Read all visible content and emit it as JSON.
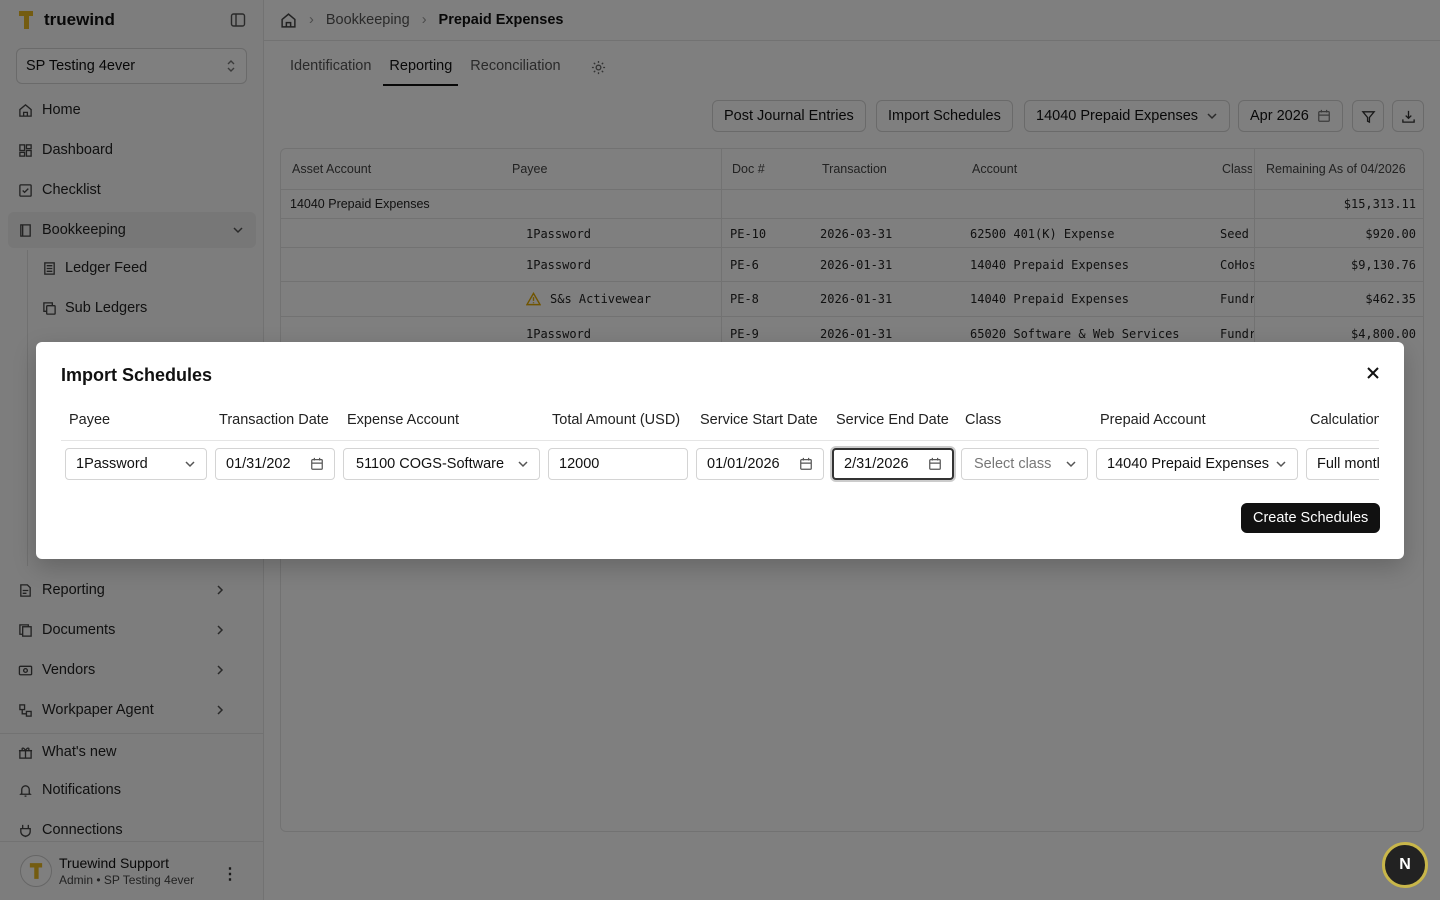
{
  "brand": {
    "name": "truewind"
  },
  "org_select": {
    "value": "SP Testing 4ever"
  },
  "nav": {
    "home": "Home",
    "dashboard": "Dashboard",
    "checklist": "Checklist",
    "bookkeeping": "Bookkeeping",
    "ledger_feed": "Ledger Feed",
    "sub_ledgers": "Sub Ledgers",
    "reporting": "Reporting",
    "documents": "Documents",
    "vendors": "Vendors",
    "workpaper_agent": "Workpaper Agent",
    "whats_new": "What's new",
    "notifications": "Notifications",
    "connections": "Connections"
  },
  "user": {
    "name": "Truewind Support",
    "role": "Admin • SP Testing 4ever"
  },
  "breadcrumb": {
    "parent": "Bookkeeping",
    "current": "Prepaid Expenses"
  },
  "tabs": {
    "identification": "Identification",
    "reporting": "Reporting",
    "reconciliation": "Reconciliation"
  },
  "toolbar": {
    "post": "Post Journal Entries",
    "import": "Import Schedules",
    "account": "14040 Prepaid Expenses",
    "period": "Apr 2026"
  },
  "table": {
    "headers": {
      "asset": "Asset Account",
      "payee": "Payee",
      "doc": "Doc #",
      "txn": "Transaction",
      "account": "Account",
      "class": "Class",
      "remaining": "Remaining As of 04/2026"
    },
    "group": {
      "label": "14040 Prepaid Expenses",
      "total": "$15,313.11"
    },
    "rows": [
      {
        "payee": "1Password",
        "doc": "PE-10",
        "date": "2026-03-31",
        "account": "62500 401(K) Expense",
        "class": "Seed I",
        "amount": "$920.00"
      },
      {
        "payee": "1Password",
        "doc": "PE-6",
        "date": "2026-01-31",
        "account": "14040 Prepaid Expenses",
        "class": "CoHos",
        "amount": "$9,130.76"
      },
      {
        "payee": "S&s Activewear",
        "doc": "PE-8",
        "date": "2026-01-31",
        "account": "14040 Prepaid Expenses",
        "class": "Fundra",
        "amount": "$462.35"
      },
      {
        "payee": "1Password",
        "doc": "PE-9",
        "date": "2026-01-31",
        "account": "65020 Software & Web Services",
        "class": "Fundra",
        "amount": "$4,800.00"
      }
    ]
  },
  "modal": {
    "title": "Import Schedules",
    "headers": {
      "payee": "Payee",
      "txn_date": "Transaction Date",
      "expense": "Expense Account",
      "total": "Total Amount (USD)",
      "start": "Service Start Date",
      "end": "Service End Date",
      "class": "Class",
      "prepaid": "Prepaid Account",
      "calc": "Calculation"
    },
    "values": {
      "payee": "1Password",
      "txn_date": "01/31/202",
      "expense": "51100 COGS-Software",
      "total": "12000",
      "start": "01/01/2026",
      "end": "2/31/2026",
      "class_placeholder": "Select class",
      "prepaid": "14040 Prepaid Expenses",
      "calc": "Full montl"
    },
    "create": "Create Schedules"
  },
  "fab": {
    "letter": "N"
  },
  "colors": {
    "brand_yellow": "#e8b923",
    "warning": "#e0a800"
  }
}
